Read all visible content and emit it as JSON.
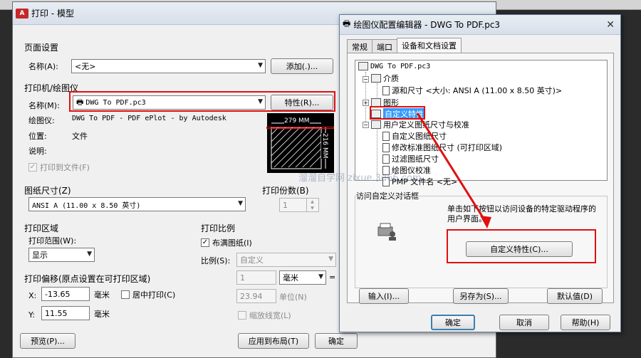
{
  "plot": {
    "title": "打印 - 模型",
    "page_setup": {
      "section": "页面设置",
      "name_label": "名称(A):",
      "name_value": "<无>",
      "add_button": "添加(.)..."
    },
    "printer": {
      "section": "打印机/绘图仪",
      "name_label": "名称(M):",
      "name_value": "DWG To PDF.pc3",
      "properties_button": "特性(R)...",
      "plotter_label": "绘图仪:",
      "plotter_value": "DWG To PDF - PDF ePlot - by Autodesk",
      "location_label": "位置:",
      "location_value": "文件",
      "description_label": "说明:",
      "plot_to_file": "打印到文件(F)",
      "preview_width": "279 MM",
      "preview_height": "216 MM"
    },
    "paper_size": {
      "section": "图纸尺寸(Z)",
      "value": "ANSI A (11.00 x 8.50 英寸)"
    },
    "copies": {
      "label": "打印份数(B)",
      "value": "1"
    },
    "plot_area": {
      "section": "打印区域",
      "range_label": "打印范围(W):",
      "range_value": "显示"
    },
    "plot_offset": {
      "section": "打印偏移(原点设置在可打印区域)",
      "x_label": "X:",
      "x_value": "-13.65",
      "x_unit": "毫米",
      "y_label": "Y:",
      "y_value": "11.55",
      "y_unit": "毫米",
      "center": "居中打印(C)"
    },
    "plot_scale": {
      "section": "打印比例",
      "fit": "布满图纸(I)",
      "scale_label": "比例(S):",
      "scale_value": "自定义",
      "value1": "1",
      "unit1": "毫米",
      "equals": "=",
      "value2": "23.94",
      "unit2": "单位(N)",
      "lineweights": "缩放线宽(L)"
    },
    "buttons": {
      "preview": "预览(P)...",
      "apply_layout": "应用到布局(T)",
      "ok": "确定"
    }
  },
  "config": {
    "title": "绘图仪配置编辑器 - DWG To PDF.pc3",
    "tabs": [
      "常规",
      "端口",
      "设备和文档设置"
    ],
    "tree": {
      "root": "DWG To PDF.pc3",
      "media": "介质",
      "source_size": "源和尺寸 <大小: ANSI A (11.00 x 8.50 英寸)>",
      "graphics": "图形",
      "custom_properties": "自定义特性",
      "user_defined": "用户定义图纸尺寸与校准",
      "custom_paper": "自定义图纸尺寸",
      "modify_paper": "修改标准图纸尺寸 (可打印区域)",
      "filter_paper": "过滤图纸尺寸",
      "calibration": "绘图仪校准",
      "pmp": "PMP 文件名 <无>"
    },
    "access": {
      "section": "访问自定义对话框",
      "description": "单击如下按钮以访问设备的特定驱动程序的用户界面。",
      "custom_button": "自定义特性(C)..."
    },
    "buttons": {
      "import": "输入(I)...",
      "save_as": "另存为(S)...",
      "defaults": "默认值(D)",
      "ok": "确定",
      "cancel": "取消",
      "help": "帮助(H)"
    },
    "watermark": "溜溜自学网 zixue.3d66.com"
  },
  "colors": {
    "highlight": "#e01010",
    "selection": "#3399ff"
  }
}
